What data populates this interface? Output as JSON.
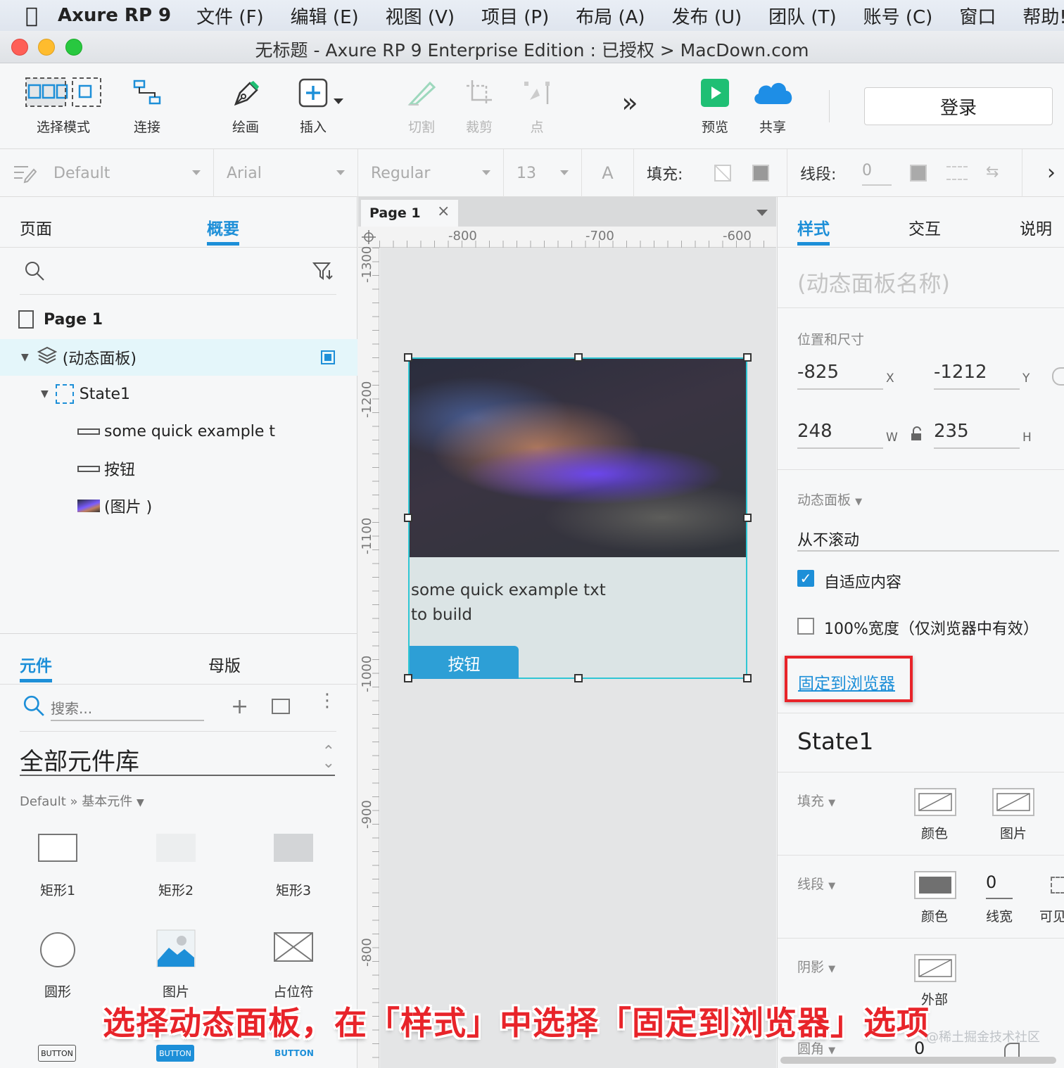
{
  "menubar": {
    "app_name": "Axure RP 9",
    "items": [
      "文件 (F)",
      "编辑 (E)",
      "视图 (V)",
      "项目 (P)",
      "布局 (A)",
      "发布 (U)",
      "团队 (T)",
      "账号 (C)",
      "窗口",
      "帮助!"
    ]
  },
  "window": {
    "title": "无标题 - Axure RP 9 Enterprise Edition : 已授权 > MacDown.com"
  },
  "toolbar": {
    "select_mode": "选择模式",
    "connect": "连接",
    "draw": "绘画",
    "insert": "插入",
    "slice": "切割",
    "crop": "裁剪",
    "point": "点",
    "more": "»",
    "preview": "预览",
    "share": "共享",
    "login": "登录"
  },
  "format_bar": {
    "style": "Default",
    "font": "Arial",
    "weight": "Regular",
    "size": "13",
    "fill_label": "填充:",
    "stroke_label": "线段:",
    "stroke_value": "0"
  },
  "outline": {
    "tab_pages": "页面",
    "tab_outline": "概要",
    "page_name": "Page 1",
    "dynamic_panel": "(动态面板)",
    "state": "State1",
    "children": [
      "some quick example t",
      "按钮",
      "(图片 )"
    ]
  },
  "library": {
    "tab_widgets": "元件",
    "tab_masters": "母版",
    "search_placeholder": "搜索...",
    "library_name": "全部元件库",
    "breadcrumb": "Default » 基本元件",
    "widgets": [
      "矩形1",
      "矩形2",
      "矩形3",
      "圆形",
      "图片",
      "占位符"
    ],
    "button_labels": [
      "BUTTON",
      "BUTTON",
      "BUTTON"
    ]
  },
  "canvas": {
    "page_tab": "Page 1",
    "ruler_top": [
      "-800",
      "-700",
      "-600"
    ],
    "ruler_left": [
      "-1300",
      "-1200",
      "-1100",
      "-1000",
      "-900",
      "-800"
    ],
    "panel_text": "some quick example txt to build",
    "panel_button": "按钮"
  },
  "inspector": {
    "tab_style": "样式",
    "tab_interact": "交互",
    "tab_notes": "说明",
    "name_placeholder": "(动态面板名称)",
    "pos_size_label": "位置和尺寸",
    "x": "-825",
    "x_unit": "X",
    "y": "-1212",
    "y_unit": "Y",
    "w": "248",
    "w_unit": "W",
    "h": "235",
    "h_unit": "H",
    "dyn_panel_label": "动态面板",
    "scroll_value": "从不滚动",
    "fit_content": "自适应内容",
    "fit_content_checked": true,
    "full_width": "100%宽度（仅浏览器中有效）",
    "full_width_checked": false,
    "pin_to_browser": "固定到浏览器",
    "state_name": "State1",
    "fill_label": "填充",
    "fill_color": "颜色",
    "fill_image": "图片",
    "stroke_label": "线段",
    "stroke_color": "颜色",
    "stroke_width_value": "0",
    "stroke_width": "线宽",
    "stroke_visible": "可见",
    "shadow_label": "阴影",
    "shadow_outer": "外部",
    "corner_label": "圆角",
    "corner_value": "0"
  },
  "overlay": {
    "caption": "选择动态面板，在「样式」中选择「固定到浏览器」选项",
    "watermark": "@稀土掘金技术社区"
  },
  "colors": {
    "accent": "#1d8fd8",
    "highlight_box": "#e8242a",
    "selection_border": "#2fc6d4",
    "preview_green": "#1fbf74",
    "share_blue": "#1e8ee6"
  }
}
